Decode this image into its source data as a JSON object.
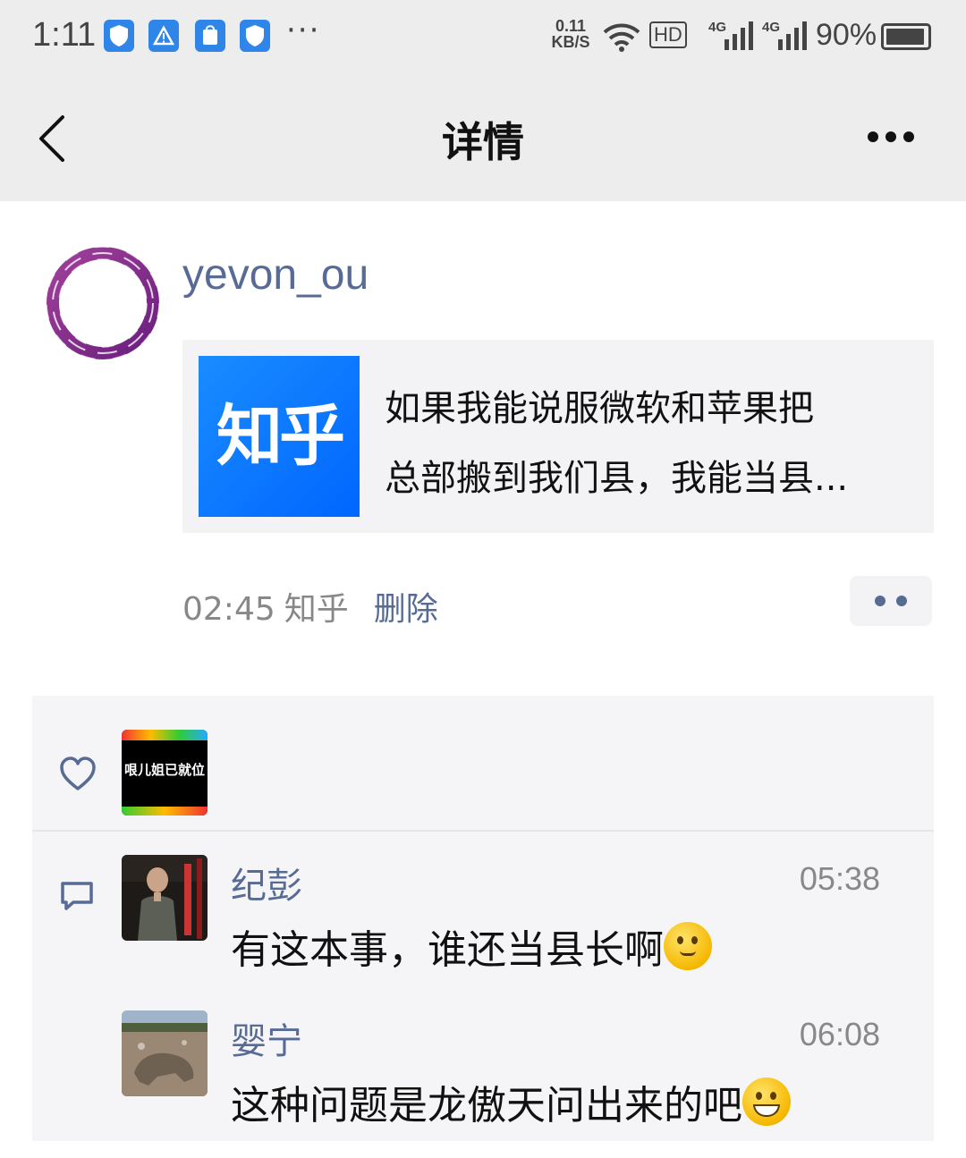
{
  "status_bar": {
    "time": "1:11",
    "speed_value": "0.11",
    "speed_unit": "KB/S",
    "hd_label": "HD",
    "network_1": "4G",
    "network_2": "4G",
    "battery_pct": "90%",
    "more": "···"
  },
  "nav": {
    "title": "详情"
  },
  "post": {
    "username": "yevon_ou",
    "share_logo_text": "知乎",
    "share_line_1": "如果我能说服微软和苹果把",
    "share_line_2": "总部搬到我们县，我能当县...",
    "time": "02:45",
    "source": "知乎",
    "delete_label": "删除"
  },
  "likes": {
    "avatar_label": "哏儿姐已就位"
  },
  "comments": [
    {
      "name": "纪彭",
      "time": "05:38",
      "text": "有这本事，谁还当县长啊"
    },
    {
      "name": "婴宁",
      "time": "06:08",
      "text": "这种问题是龙傲天问出来的吧"
    }
  ],
  "colors": {
    "link_blue": "#576b95",
    "zhihu_blue": "#0a7cff",
    "bar_gray": "#ededed"
  }
}
